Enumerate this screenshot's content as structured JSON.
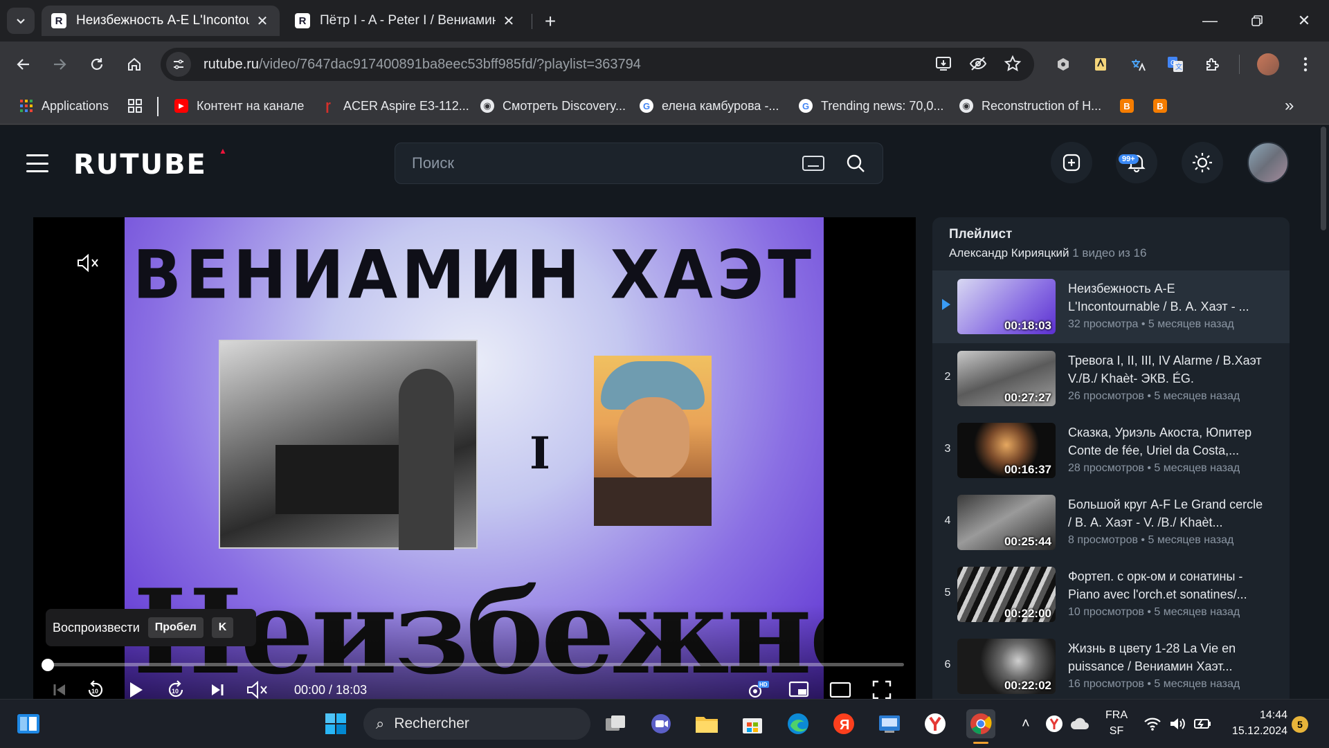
{
  "browser": {
    "tabs": [
      {
        "title": "Неизбежность A-E L'Incontournable",
        "favicon": "R",
        "active": true
      },
      {
        "title": "Пётр I - A - Peter I / Вениамин Хаэт",
        "favicon": "R",
        "active": false
      }
    ],
    "address": {
      "host": "rutube.ru",
      "path": "/video/7647dac917400891ba8eec53bff985fd/?playlist=363794"
    },
    "bookmarks": [
      {
        "label": "Applications",
        "icon": "apps-grid-icon"
      },
      {
        "label": "Контент на канале",
        "icon": "youtube-icon"
      },
      {
        "label": "ACER Aspire E3-112...",
        "icon": "acer-icon"
      },
      {
        "label": "Смотреть Discovery...",
        "icon": "globe-icon"
      },
      {
        "label": "елена камбурова -...",
        "icon": "google-icon"
      },
      {
        "label": "Trending news: 70,0...",
        "icon": "google-icon"
      },
      {
        "label": "Reconstruction of H...",
        "icon": "globe-icon"
      }
    ]
  },
  "rutube": {
    "logo": "RUTUBE",
    "search_placeholder": "Поиск",
    "notifications_badge": "99+"
  },
  "player": {
    "video_text": {
      "title": "ВЕНИАМИН  ХАЭТ",
      "numeral": "I",
      "big": "Неизбежность"
    },
    "tooltip": {
      "label": "Воспроизвести",
      "key1": "Пробел",
      "key2": "K"
    },
    "time": "00:00 / 18:03",
    "progress": 0
  },
  "playlist": {
    "title": "Плейлист",
    "author": "Александр Кирияцкий",
    "count": "1 видео из 16",
    "items": [
      {
        "index": "",
        "title": "Неизбежность A-E L'Incontournable / В. А. Хаэт - ...",
        "views": "32 просмотра",
        "ago": "5 месяцев назад",
        "duration": "00:18:03",
        "active": true
      },
      {
        "index": "2",
        "title": "Тревога I, II, III, IV Alarme / В.Хаэт V./B./ Khaèt- ЭКВ. ÉG.",
        "views": "26 просмотров",
        "ago": "5 месяцев назад",
        "duration": "00:27:27",
        "active": false
      },
      {
        "index": "3",
        "title": "Сказка, Уриэль Акоста, Юпитер Conte de fée, Uriel da Costa,...",
        "views": "28 просмотров",
        "ago": "5 месяцев назад",
        "duration": "00:16:37",
        "active": false
      },
      {
        "index": "4",
        "title": "Большой круг A-F Le Grand cercle / В. А. Хаэт - V. /B./ Khaèt...",
        "views": "8 просмотров",
        "ago": "5 месяцев назад",
        "duration": "00:25:44",
        "active": false
      },
      {
        "index": "5",
        "title": "Фортеп. с орк-ом и сонатины - Piano avec l'orch.et sonatines/...",
        "views": "10 просмотров",
        "ago": "5 месяцев назад",
        "duration": "00:22:00",
        "active": false
      },
      {
        "index": "6",
        "title": "Жизнь в цвету 1-28 La Vie en puissance / Вениамин Хаэт...",
        "views": "16 просмотров",
        "ago": "5 месяцев назад",
        "duration": "00:22:02",
        "active": false
      }
    ]
  },
  "taskbar": {
    "search_placeholder": "Rechercher",
    "lang": "FRA",
    "layout": "SF",
    "time": "14:44",
    "date": "15.12.2024",
    "notification_count": "5"
  }
}
